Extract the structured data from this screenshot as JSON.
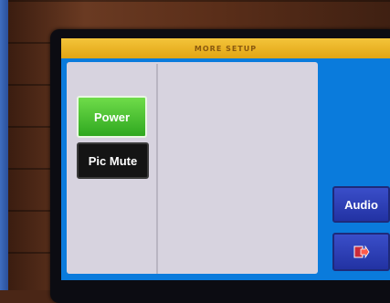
{
  "screen": {
    "title": "MORE SETUP"
  },
  "buttons": {
    "power_label": "Power",
    "pic_mute_label": "Pic Mute",
    "audio_label": "Audio"
  },
  "icons": {
    "nav_icon": "exit-arrow-icon"
  },
  "colors": {
    "screen_blue": "#0a7bdc",
    "title_yellow": "#e2a514",
    "power_active_green": "#2fa81f",
    "audio_button_blue": "#2232a3"
  }
}
